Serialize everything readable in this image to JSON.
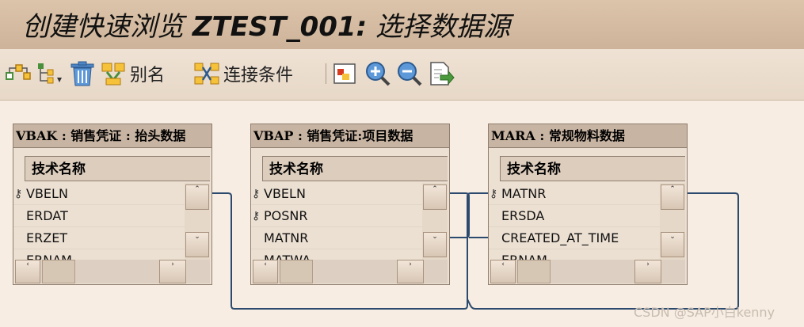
{
  "window": {
    "title_prefix": "创建快速浏览 ",
    "title_query": "ZTEST_001:",
    "title_suffix": " 选择数据源"
  },
  "toolbar": {
    "alias_label": "别名",
    "join_label": "连接条件"
  },
  "tables": [
    {
      "header": "VBAK : 销售凭证 :  抬头数据",
      "column_header": "技术名称",
      "rows": [
        {
          "key": true,
          "name": "VBELN"
        },
        {
          "key": false,
          "name": "ERDAT"
        },
        {
          "key": false,
          "name": "ERZET"
        },
        {
          "key": false,
          "name": "ERNAM"
        }
      ]
    },
    {
      "header": "VBAP : 销售凭证:项目数据",
      "column_header": "技术名称",
      "rows": [
        {
          "key": true,
          "name": "VBELN"
        },
        {
          "key": true,
          "name": "POSNR"
        },
        {
          "key": false,
          "name": "MATNR"
        },
        {
          "key": false,
          "name": "MATWA"
        }
      ]
    },
    {
      "header": "MARA : 常规物料数据",
      "column_header": "技术名称",
      "rows": [
        {
          "key": true,
          "name": "MATNR"
        },
        {
          "key": false,
          "name": "ERSDA"
        },
        {
          "key": false,
          "name": "CREATED_AT_TIME"
        },
        {
          "key": false,
          "name": "ERNAM"
        }
      ]
    }
  ],
  "watermark": "CSDN @SAP小白kenny",
  "colors": {
    "title_bar": "#cdb399",
    "canvas": "#f7ede2",
    "table_header": "#c8b4a2",
    "join_line": "#2c4a6e"
  }
}
